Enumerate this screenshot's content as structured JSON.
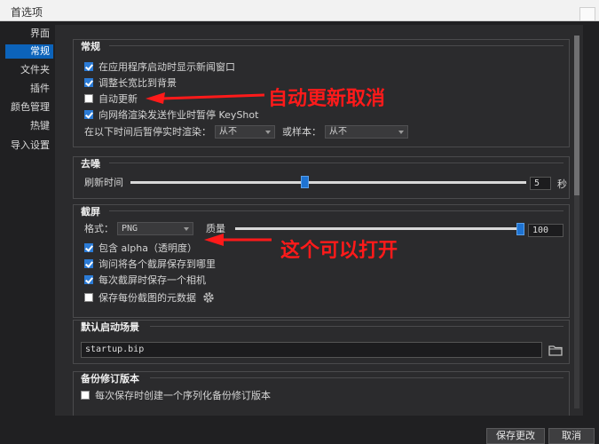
{
  "window": {
    "title": "首选项"
  },
  "sidebar": {
    "items": [
      {
        "label": "界面"
      },
      {
        "label": "常规",
        "active": true
      },
      {
        "label": "文件夹"
      },
      {
        "label": "插件"
      },
      {
        "label": "颜色管理"
      },
      {
        "label": "热键"
      },
      {
        "label": "导入设置"
      }
    ]
  },
  "general": {
    "title": "常规",
    "options": [
      {
        "label": "在应用程序启动时显示新闻窗口",
        "checked": true
      },
      {
        "label": "调整长宽比到背景",
        "checked": true
      },
      {
        "label": "自动更新",
        "checked": false
      },
      {
        "label": "向网络渲染发送作业时暂停 KeyShot",
        "checked": true
      }
    ],
    "pause_label": "在以下时间后暂停实时渲染：",
    "pause_value": "从不",
    "samples_label": "或样本：",
    "samples_value": "从不"
  },
  "denoise": {
    "title": "去噪",
    "refresh_label": "刷新时间",
    "refresh_value": "5",
    "refresh_slider_fraction": 0.44,
    "unit": "秒"
  },
  "screenshot": {
    "title": "截屏",
    "format_label": "格式：",
    "format_value": "PNG",
    "quality_label": "质量",
    "quality_value": "100",
    "quality_slider_fraction": 1.0,
    "options": [
      {
        "label": "包含 alpha（透明度）",
        "checked": true
      },
      {
        "label": "询问将各个截屏保存到哪里",
        "checked": true
      },
      {
        "label": "每次截屏时保存一个相机",
        "checked": true
      },
      {
        "label": "保存每份截图的元数据",
        "checked": false
      }
    ]
  },
  "startup": {
    "title": "默认启动场景",
    "path": "startup.bip"
  },
  "backup": {
    "title": "备份修订版本",
    "option": {
      "label": "每次保存时创建一个序列化备份修订版本",
      "checked": false
    }
  },
  "annotations": {
    "auto_update_cancel": "自动更新取消",
    "alpha_can_open": "这个可以打开"
  },
  "footer": {
    "save_label": "保存更改",
    "cancel_label": "取消"
  },
  "colors": {
    "annotation": "#ff1a1a",
    "accent": "#0c63ba",
    "slider_thumb": "#1e73d2"
  }
}
